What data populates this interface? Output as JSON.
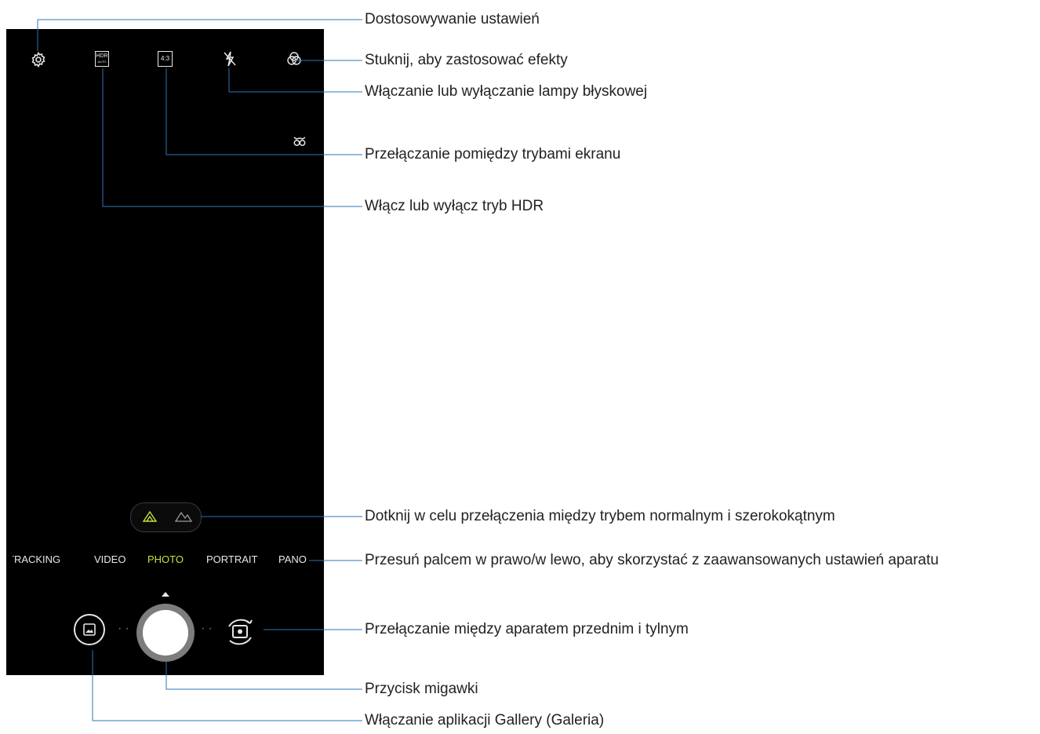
{
  "camera": {
    "top_icons": [
      "settings-gear-icon",
      "hdr-auto-icon",
      "aspect-ratio-icon",
      "flash-off-icon",
      "effects-filter-icon"
    ],
    "aspect_ratio_label": "4:3",
    "hdr_label": "HDR",
    "hdr_sub_label": "AUTO",
    "side_icon": "owl-icon",
    "lens_toggle_icons": [
      "normal-lens-icon",
      "wide-lens-icon"
    ],
    "modes": [
      "TRACKING",
      "VIDEO",
      "PHOTO",
      "PORTRAIT",
      "PANO"
    ],
    "active_mode": "PHOTO",
    "colors": {
      "active_mode": "#c8e03a",
      "callout_line": "#2f74b5",
      "screen_bg": "#000000"
    }
  },
  "callouts": {
    "settings": "Dostosowywanie ustawień",
    "effects": "Stuknij, aby zastosować efekty",
    "flash": "Włączanie lub wyłączanie lampy błyskowej",
    "screen_modes": "Przełączanie pomiędzy trybami ekranu",
    "hdr": "Włącz lub wyłącz tryb HDR",
    "lens": "Dotknij w celu przełączenia między trybem normalnym i szerokokątnym",
    "swipe_modes": "Przesuń palcem w prawo/w lewo, aby skorzystać z zaawansowanych ustawień aparatu",
    "switch_camera": "Przełączanie między aparatem przednim i tylnym",
    "shutter": "Przycisk migawki",
    "gallery": "Włączanie aplikacji Gallery (Galeria)"
  }
}
